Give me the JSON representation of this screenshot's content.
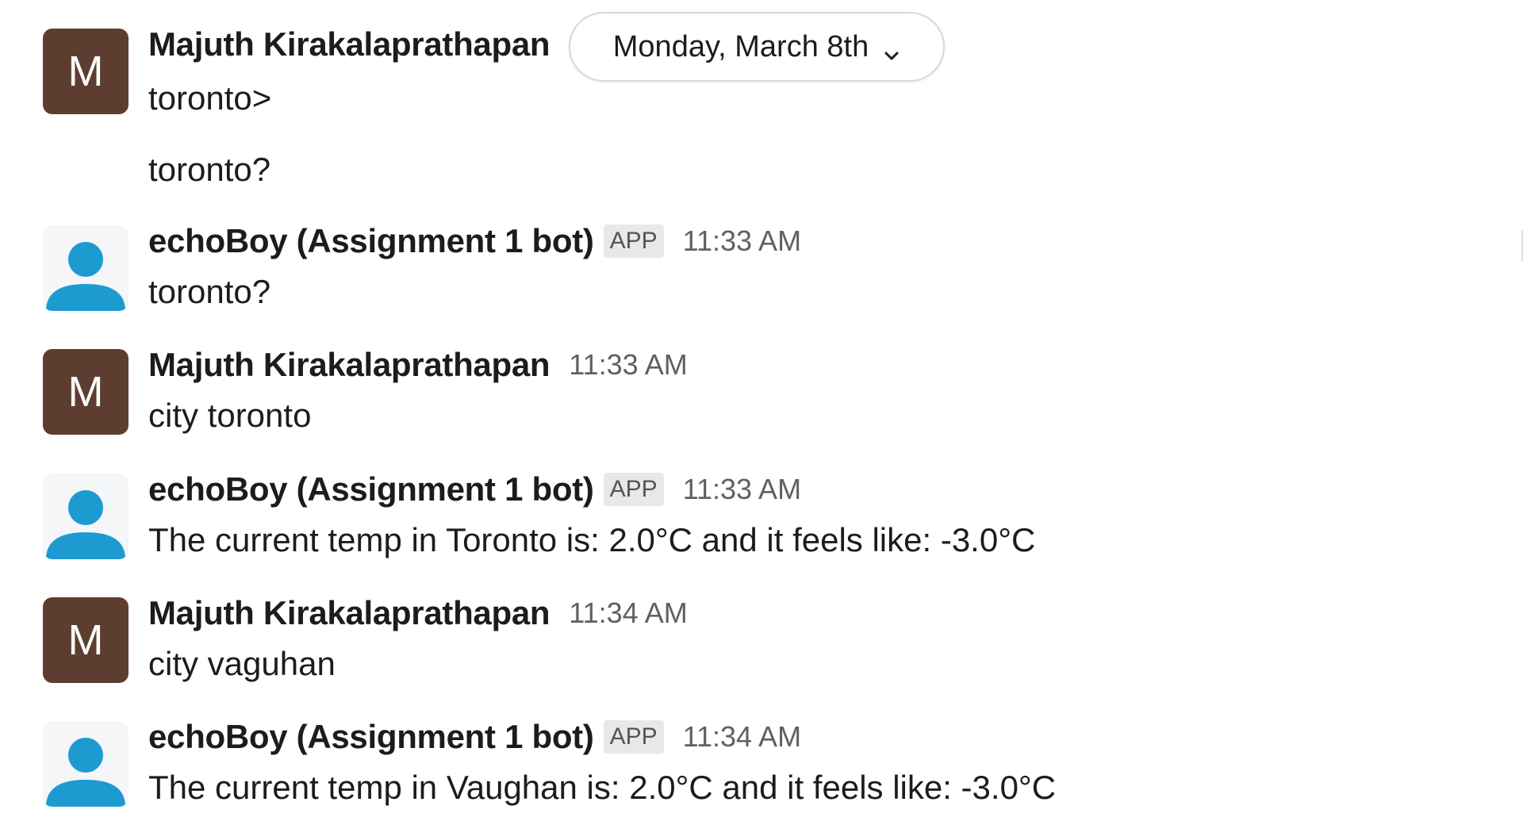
{
  "date_divider": {
    "label": "Monday, March 8th"
  },
  "messages": [
    {
      "author": "Majuth Kirakalaprathapan",
      "avatar_letter": "M",
      "lines": [
        "toronto>",
        "toronto?"
      ]
    },
    {
      "author": "echoBoy (Assignment 1 bot)",
      "badge": "APP",
      "time": "11:33 AM",
      "lines": [
        "toronto?"
      ]
    },
    {
      "author": "Majuth Kirakalaprathapan",
      "avatar_letter": "M",
      "time": "11:33 AM",
      "lines": [
        "city toronto"
      ]
    },
    {
      "author": "echoBoy (Assignment 1 bot)",
      "badge": "APP",
      "time": "11:33 AM",
      "lines": [
        "The current temp in Toronto is: 2.0°C and it feels like: -3.0°C"
      ]
    },
    {
      "author": "Majuth Kirakalaprathapan",
      "avatar_letter": "M",
      "time": "11:34 AM",
      "lines": [
        "city vaguhan"
      ]
    },
    {
      "author": "echoBoy (Assignment 1 bot)",
      "badge": "APP",
      "time": "11:34 AM",
      "lines": [
        "The current temp in Vaughan is: 2.0°C and it feels like: -3.0°C"
      ]
    }
  ],
  "colors": {
    "user_avatar_bg": "#5e3d31",
    "bot_avatar_fg": "#1d9bd1",
    "badge_bg": "#e8e8e8"
  },
  "icons": {
    "bot_avatar": "person-icon",
    "date_chevron": "chevron-down-icon"
  }
}
